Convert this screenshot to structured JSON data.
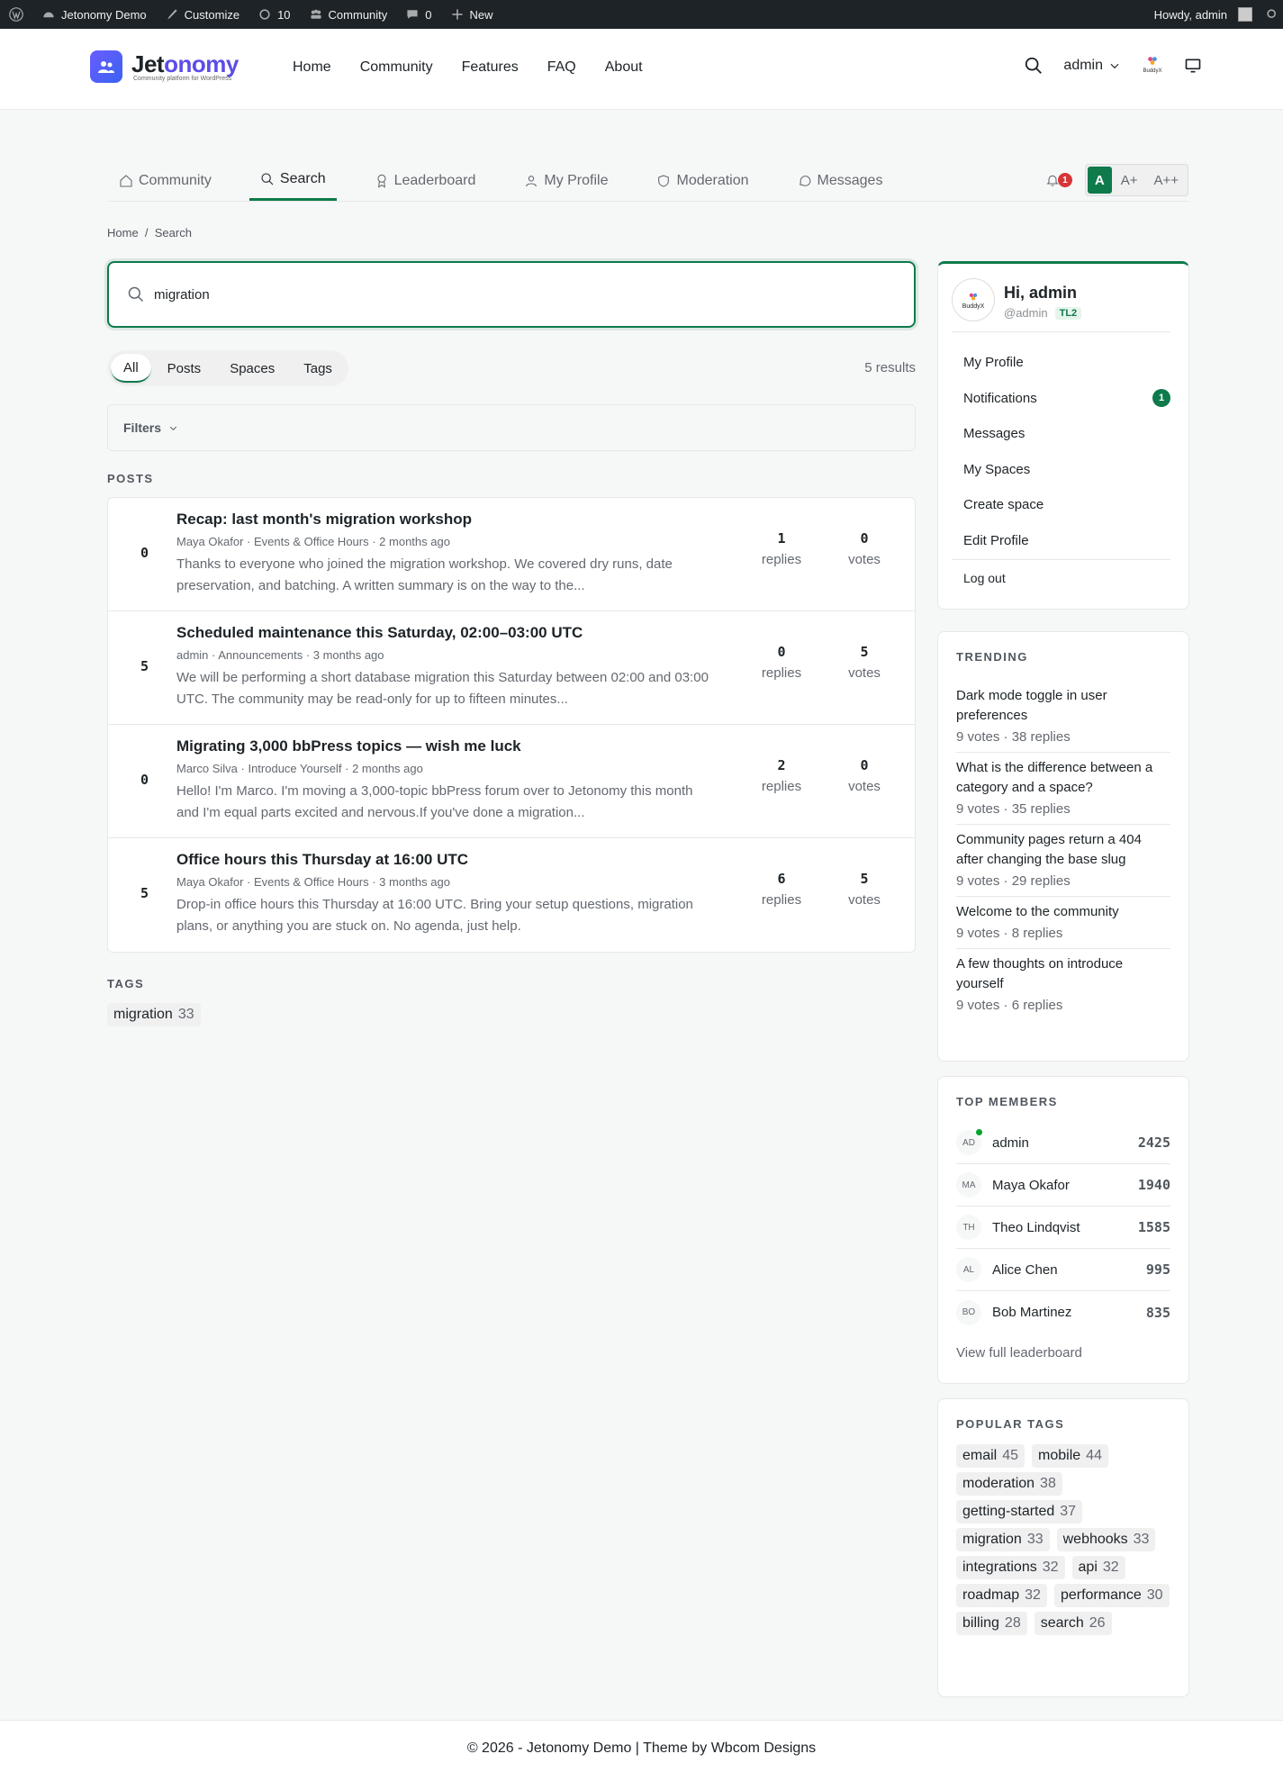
{
  "adminbar": {
    "site": "Jetonomy Demo",
    "customize": "Customize",
    "updates": "10",
    "community": "Community",
    "comments": "0",
    "new": "New",
    "howdy": "Howdy, admin"
  },
  "header": {
    "logo_name_a": "Jet",
    "logo_name_b": "onomy",
    "logo_tagline": "Community platform for WordPress",
    "nav": [
      "Home",
      "Community",
      "Features",
      "FAQ",
      "About"
    ],
    "user": "admin",
    "buddyx": "BuddyX"
  },
  "tabs": [
    {
      "label": "Community",
      "icon": "home-icon"
    },
    {
      "label": "Search",
      "icon": "search-icon"
    },
    {
      "label": "Leaderboard",
      "icon": "award-icon"
    },
    {
      "label": "My Profile",
      "icon": "user-icon"
    },
    {
      "label": "Moderation",
      "icon": "shield-icon"
    },
    {
      "label": "Messages",
      "icon": "chat-icon"
    }
  ],
  "notif_count": "1",
  "font_sizes": [
    "A",
    "A+",
    "A++"
  ],
  "breadcrumb": "Home  /  Search",
  "search": {
    "value": "migration"
  },
  "type_tabs": [
    "All",
    "Posts",
    "Spaces",
    "Tags"
  ],
  "results_count": "5 results",
  "filters_label": "Filters",
  "posts_label": "POSTS",
  "posts": [
    {
      "score": "0",
      "title": "Recap: last month's migration workshop",
      "meta": "Maya Okafor · Events & Office Hours · 2 months ago",
      "excerpt": "Thanks to everyone who joined the migration workshop. We covered dry runs, date preservation, and batching. A written summary is on the way to the...",
      "replies": "1",
      "votes": "0"
    },
    {
      "score": "5",
      "title": "Scheduled maintenance this Saturday, 02:00–03:00 UTC",
      "meta": "admin · Announcements · 3 months ago",
      "excerpt": "We will be performing a short database migration this Saturday between 02:00 and 03:00 UTC. The community may be read-only for up to fifteen minutes...",
      "replies": "0",
      "votes": "5"
    },
    {
      "score": "0",
      "title": "Migrating 3,000 bbPress topics — wish me luck",
      "meta": "Marco Silva · Introduce Yourself · 2 months ago",
      "excerpt": "Hello! I'm Marco. I'm moving a 3,000-topic bbPress forum over to Jetonomy this month and I'm equal parts excited and nervous.If you've done a migration...",
      "replies": "2",
      "votes": "0"
    },
    {
      "score": "5",
      "title": "Office hours this Thursday at 16:00 UTC",
      "meta": "Maya Okafor · Events & Office Hours · 3 months ago",
      "excerpt": "Drop-in office hours this Thursday at 16:00 UTC. Bring your setup questions, migration plans, or anything you are stuck on. No agenda, just help.",
      "replies": "6",
      "votes": "5"
    }
  ],
  "stat_labels": {
    "replies": "replies",
    "votes": "votes"
  },
  "tags_label": "TAGS",
  "tags": [
    {
      "name": "migration",
      "count": "33"
    }
  ],
  "user_card": {
    "hi": "Hi, admin",
    "handle": "@admin",
    "level": "TL2",
    "menu": [
      "My Profile",
      "Notifications",
      "Messages",
      "My Spaces",
      "Create space",
      "Edit Profile"
    ],
    "notif_badge": "1",
    "logout": "Log out"
  },
  "trending": {
    "title": "TRENDING",
    "items": [
      {
        "title": "Dark mode toggle in user preferences",
        "meta": "9 votes · 38 replies"
      },
      {
        "title": "What is the difference between a category and a space?",
        "meta": "9 votes · 35 replies"
      },
      {
        "title": "Community pages return a 404 after changing the base slug",
        "meta": "9 votes · 29 replies"
      },
      {
        "title": "Welcome to the community",
        "meta": "9 votes · 8 replies"
      },
      {
        "title": "A few thoughts on introduce yourself",
        "meta": "9 votes · 6 replies"
      }
    ]
  },
  "members": {
    "title": "TOP MEMBERS",
    "items": [
      {
        "initials": "AD",
        "name": "admin",
        "points": "2425",
        "online": true
      },
      {
        "initials": "MA",
        "name": "Maya Okafor",
        "points": "1940"
      },
      {
        "initials": "TH",
        "name": "Theo Lindqvist",
        "points": "1585"
      },
      {
        "initials": "AL",
        "name": "Alice Chen",
        "points": "995"
      },
      {
        "initials": "BO",
        "name": "Bob Martinez",
        "points": "835"
      }
    ],
    "link": "View full leaderboard"
  },
  "popular_tags": {
    "title": "POPULAR TAGS",
    "items": [
      {
        "name": "email",
        "count": "45"
      },
      {
        "name": "mobile",
        "count": "44"
      },
      {
        "name": "moderation",
        "count": "38"
      },
      {
        "name": "getting-started",
        "count": "37"
      },
      {
        "name": "migration",
        "count": "33"
      },
      {
        "name": "webhooks",
        "count": "33"
      },
      {
        "name": "integrations",
        "count": "32"
      },
      {
        "name": "api",
        "count": "32"
      },
      {
        "name": "roadmap",
        "count": "32"
      },
      {
        "name": "performance",
        "count": "30"
      },
      {
        "name": "billing",
        "count": "28"
      },
      {
        "name": "search",
        "count": "26"
      }
    ]
  },
  "footer": "© 2026 - Jetonomy Demo | Theme by Wbcom Designs",
  "colors": {
    "accent": "#0f7a4b",
    "brand": "#5b4de8",
    "danger": "#d63638"
  }
}
